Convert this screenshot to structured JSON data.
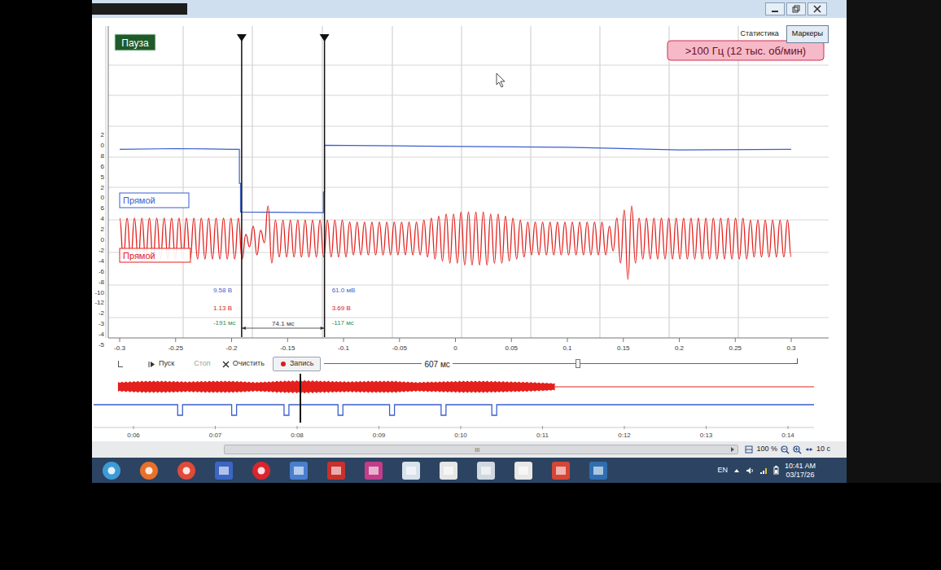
{
  "toolbar": {
    "tabs": [
      {
        "label": "Статистика",
        "selected": false
      },
      {
        "label": "Маркеры",
        "selected": true
      }
    ]
  },
  "status_badge": "Пауза",
  "frequency_badge": ">100 Гц (12 тыс. об/мин)",
  "chart": {
    "x_ticks": [
      "-0.3",
      "-0.25",
      "-0.2",
      "-0.15",
      "-0.1",
      "-0.05",
      "0",
      "0.05",
      "0.1",
      "0.15",
      "0.2",
      "0.25",
      "0.3"
    ],
    "y_ticks": [
      "2",
      "0",
      "8",
      "6",
      "5",
      "2",
      "0",
      "6",
      "4",
      "2",
      "0",
      "-2",
      "-4",
      "-6",
      "-8",
      "-10",
      "-12",
      "-2",
      "-3",
      "-4",
      "-5"
    ],
    "series": [
      {
        "name": "Прямой",
        "color": "#3a5fcd",
        "times": [
          -0.3,
          -0.25,
          -0.2,
          -0.193,
          -0.193,
          -0.192,
          -0.192,
          -0.12,
          -0.118,
          -0.118,
          -0.117,
          -0.117,
          -0.05,
          0.1,
          0.2,
          0.3
        ],
        "values": [
          9.6,
          9.7,
          9.6,
          9.6,
          4.5,
          4.5,
          0.2,
          0.1,
          0.1,
          3.2,
          3.2,
          10.2,
          10.1,
          9.9,
          9.5,
          9.6
        ]
      },
      {
        "name": "Прямой",
        "color": "#e3201c",
        "start": -0.3,
        "end": 0.3,
        "values": [
          5,
          -5,
          5,
          -5,
          5,
          -5,
          5,
          -5,
          5,
          -5,
          5,
          -5,
          5,
          -5,
          5,
          -5,
          5,
          -5,
          5,
          -5,
          5,
          -5,
          5,
          -5,
          5,
          -5,
          5,
          -5,
          5,
          -5,
          5,
          -5,
          5,
          -5,
          1,
          -2,
          3,
          -4,
          2,
          -1,
          8,
          -6,
          4.5,
          -4.5,
          4.5,
          -4.5,
          4.5,
          -4.5,
          4.5,
          -4.5,
          4.5,
          -4.5,
          4.5,
          -4.5,
          4.5,
          -4.5,
          4.5,
          -4.5,
          4.5,
          -4.5,
          4.5,
          -4.5,
          4,
          -4,
          4,
          -4,
          4,
          -4,
          4,
          -4,
          4,
          -4,
          4,
          -4,
          4,
          -4,
          4,
          -4,
          4,
          -4,
          4,
          -4,
          4.5,
          -4.5,
          5,
          -5,
          5.5,
          -5.5,
          6,
          -6,
          6,
          -6,
          6.5,
          -6.5,
          6.5,
          -6.5,
          6.5,
          -6.5,
          6.5,
          -6.5,
          6,
          -6,
          6,
          -6,
          5.5,
          -5.5,
          5,
          -5,
          4.5,
          -4.5,
          4,
          -4,
          4,
          -4,
          4,
          -4,
          4,
          -4,
          4,
          -4,
          4,
          -4,
          4,
          -4,
          4,
          -4,
          4,
          -4,
          4,
          -4,
          4,
          -4,
          3,
          -3,
          5,
          -6,
          7,
          -10,
          8,
          -6,
          5,
          -5,
          5,
          -5,
          5,
          -5,
          5,
          -5,
          5,
          -5,
          5,
          -5,
          5,
          -5,
          5,
          -5,
          5,
          -5,
          5,
          -5,
          5,
          -5,
          5,
          -5,
          5,
          -5,
          5,
          -5,
          5,
          -5,
          4.5,
          -4.5,
          4.5,
          -4.5,
          4.5,
          -4.5,
          4.5,
          -4.5,
          4.5,
          -4.5,
          4.5,
          -4.5
        ]
      }
    ],
    "reading_colors": [
      "#3a5fcd",
      "#d4201c",
      "#2e8b57"
    ],
    "markers": [
      {
        "time": -0.191,
        "readings": [
          "9.58 В",
          "1.13 В",
          "-191 мс"
        ]
      },
      {
        "time": -0.117,
        "readings": [
          "61.0 мВ",
          "3.69 В",
          "-117 мс"
        ]
      }
    ],
    "marker_delta": "74.1 мс"
  },
  "controls": {
    "buttons": [
      {
        "label": "Пуск",
        "kind": "play",
        "disabled": false
      },
      {
        "label": "Стоп",
        "kind": "plain",
        "disabled": true
      },
      {
        "label": "Очистить",
        "kind": "clear",
        "disabled": false
      },
      {
        "label": "Запись",
        "kind": "record",
        "disabled": false
      }
    ]
  },
  "timeline": {
    "window": "607 мс",
    "level": 0.53
  },
  "overview": {
    "ticks": [
      "0:06",
      "0:07",
      "0:08",
      "0:09",
      "0:10",
      "0:11",
      "0:12",
      "0:13",
      "0:14"
    ],
    "start": 5.81,
    "end": 11.15,
    "envelope": [
      4,
      5,
      5,
      4.5,
      5,
      5,
      4,
      5,
      5.5,
      5,
      4.5,
      5,
      5,
      4,
      4.5,
      5,
      5,
      4.5,
      4,
      3
    ],
    "pulses": [
      6.57,
      7.23,
      7.87,
      8.53,
      9.16,
      9.79,
      10.41
    ],
    "cursor": 8.04
  },
  "scrollbar": {
    "grip": "III",
    "zoom": "100 %",
    "span": "10 с"
  },
  "taskbar": {
    "language": "EN",
    "time": "10:41 AM",
    "date": "03/17/26"
  }
}
